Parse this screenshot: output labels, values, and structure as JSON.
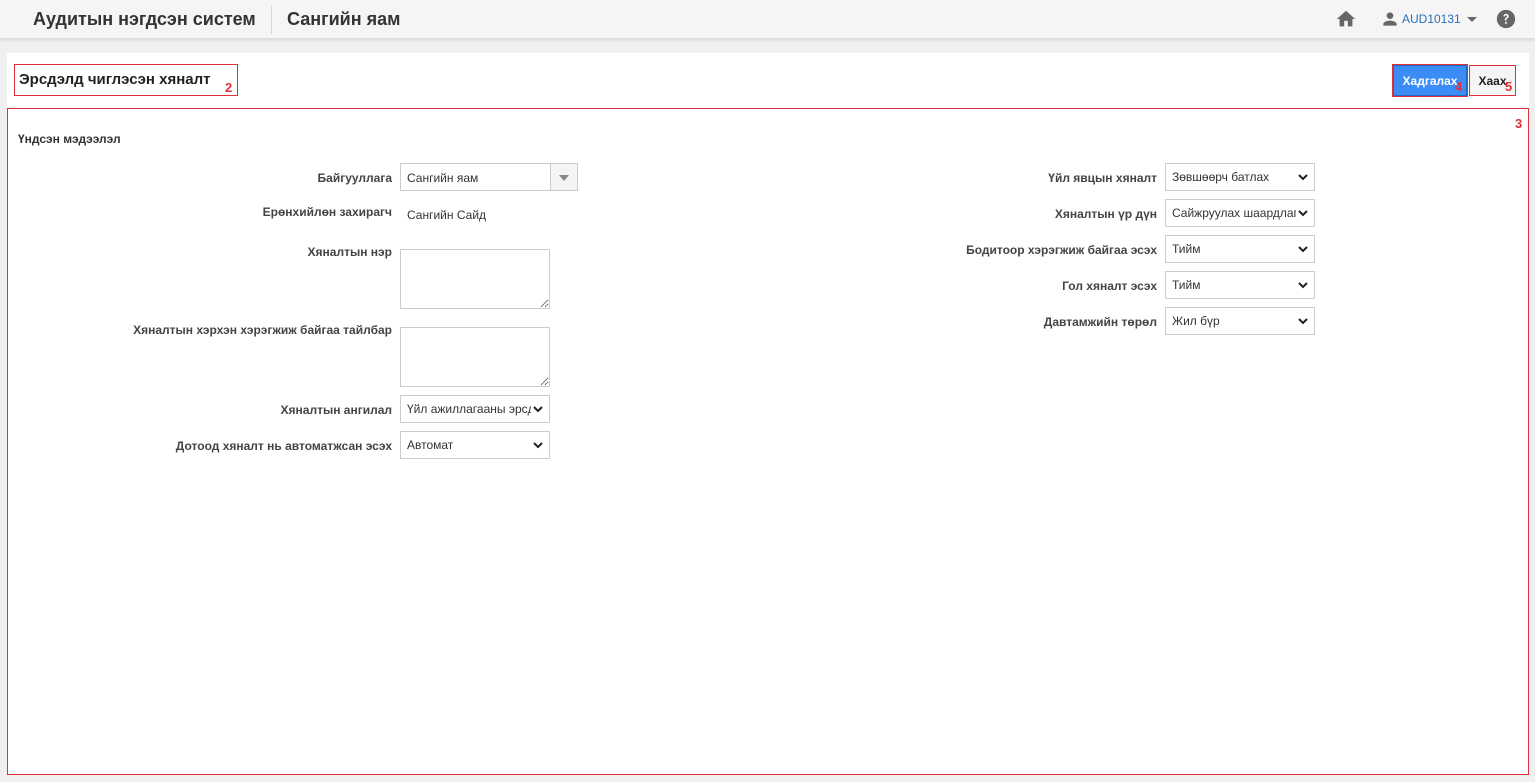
{
  "header": {
    "app_title": "Аудитын нэгдсэн систем",
    "org_title": "Сангийн яам",
    "user_name": "AUD10131",
    "icons": [
      "home-icon",
      "user-icon",
      "caret-down-icon",
      "help-icon"
    ]
  },
  "page": {
    "title": "Эрсдэлд чиглэсэн хяналт",
    "markers": {
      "title": "2",
      "form": "3",
      "save": "4",
      "close": "5"
    },
    "save_label": "Хадгалах",
    "close_label": "Хаах"
  },
  "form": {
    "section_title": "Үндсэн мэдээлэл",
    "left": {
      "organization_label": "Байгууллага",
      "organization_value": "Сангийн яам",
      "director_label": "Ерөнхийлөн захирагч",
      "director_value": "Сангийн Сайд",
      "control_name_label": "Хяналтын нэр",
      "control_name_value": "",
      "description_label": "Хяналтын хэрхэн хэрэгжиж байгаа тайлбар",
      "description_value": "",
      "category_label": "Хяналтын ангилал",
      "category_value": "Үйл ажиллагааны эрсдэл",
      "automated_label": "Дотоод хяналт нь автоматжсан эсэх",
      "automated_value": "Автомат"
    },
    "right": {
      "process_control_label": "Үйл явцын хяналт",
      "process_control_value": "Зөвшөөрч батлах",
      "result_label": "Хяналтын үр дүн",
      "result_value": "Сайжруулах шаардлагатай",
      "implemented_label": "Бодитоор хэрэгжиж байгаа эсэх",
      "implemented_value": "Тийм",
      "key_control_label": "Гол хяналт эсэх",
      "key_control_value": "Тийм",
      "frequency_label": "Давтамжийн төрөл",
      "frequency_value": "Жил бүр"
    }
  }
}
